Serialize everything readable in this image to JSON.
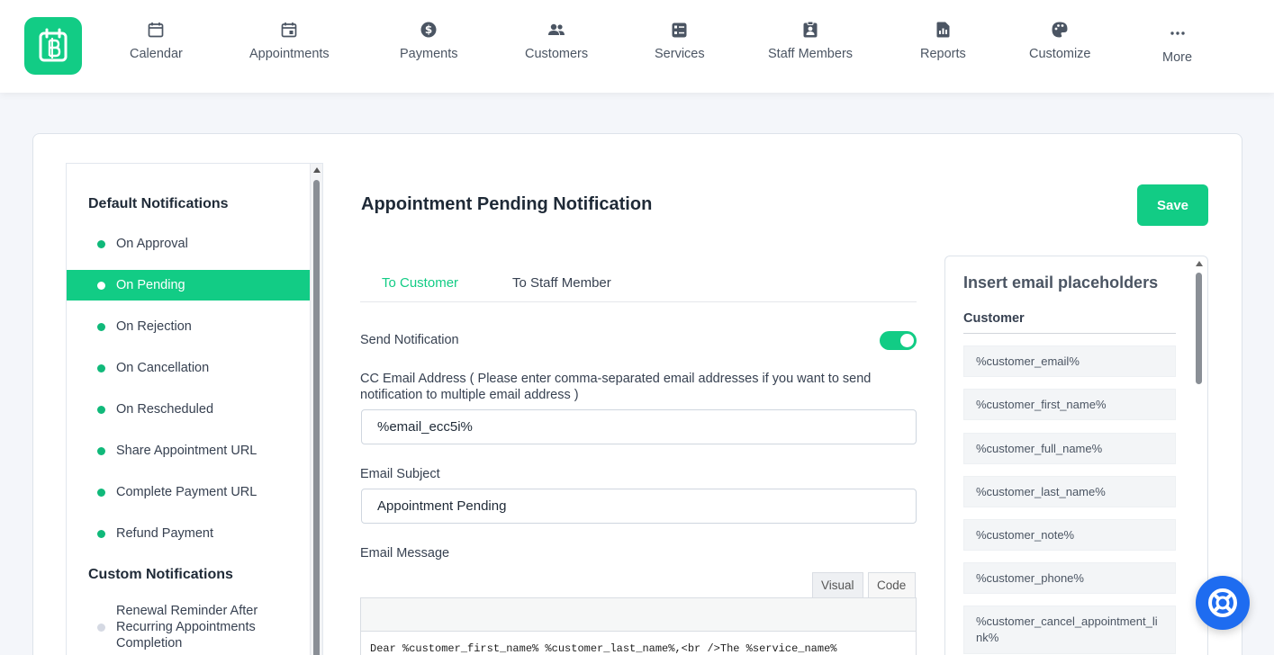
{
  "nav": {
    "items": [
      {
        "label": "Calendar",
        "icon": "calendar-icon"
      },
      {
        "label": "Appointments",
        "icon": "calendar-check-icon"
      },
      {
        "label": "Payments",
        "icon": "dollar-icon"
      },
      {
        "label": "Customers",
        "icon": "users-icon"
      },
      {
        "label": "Services",
        "icon": "services-icon"
      },
      {
        "label": "Staff Members",
        "icon": "badge-icon"
      },
      {
        "label": "Reports",
        "icon": "report-icon"
      },
      {
        "label": "Customize",
        "icon": "palette-icon"
      },
      {
        "label": "More",
        "icon": "more-icon"
      }
    ]
  },
  "sidebar": {
    "default_heading": "Default Notifications",
    "items": [
      {
        "label": "On Approval"
      },
      {
        "label": "On Pending"
      },
      {
        "label": "On Rejection"
      },
      {
        "label": "On Cancellation"
      },
      {
        "label": "On Rescheduled"
      },
      {
        "label": "Share Appointment URL"
      },
      {
        "label": "Complete Payment URL"
      },
      {
        "label": "Refund Payment"
      }
    ],
    "custom_heading": "Custom Notifications",
    "custom_items": [
      {
        "label": "Renewal Reminder After Recurring Appointments Completion"
      }
    ]
  },
  "main": {
    "title": "Appointment Pending Notification",
    "save_label": "Save",
    "tabs": [
      {
        "label": "To Customer"
      },
      {
        "label": "To Staff Member"
      }
    ],
    "send_notification_label": "Send Notification",
    "send_notification_on": true,
    "cc_label": "CC Email Address ( Please enter comma-separated email addresses if you want to send notification to multiple email address )",
    "cc_value": "%email_ecc5i%",
    "subject_label": "Email Subject",
    "subject_value": "Appointment Pending",
    "message_label": "Email Message",
    "editor_tabs": {
      "visual": "Visual",
      "code": "Code"
    },
    "message_preview": "Dear %customer_first_name% %customer_last_name%,<br />The %service_name%"
  },
  "placeholders": {
    "title": "Insert email placeholders",
    "group": "Customer",
    "items": [
      "%customer_email%",
      "%customer_first_name%",
      "%customer_full_name%",
      "%customer_last_name%",
      "%customer_note%",
      "%customer_phone%",
      "%customer_cancel_appointment_link%"
    ]
  },
  "colors": {
    "accent": "#12cc85",
    "help_button": "#1e6cf0"
  }
}
